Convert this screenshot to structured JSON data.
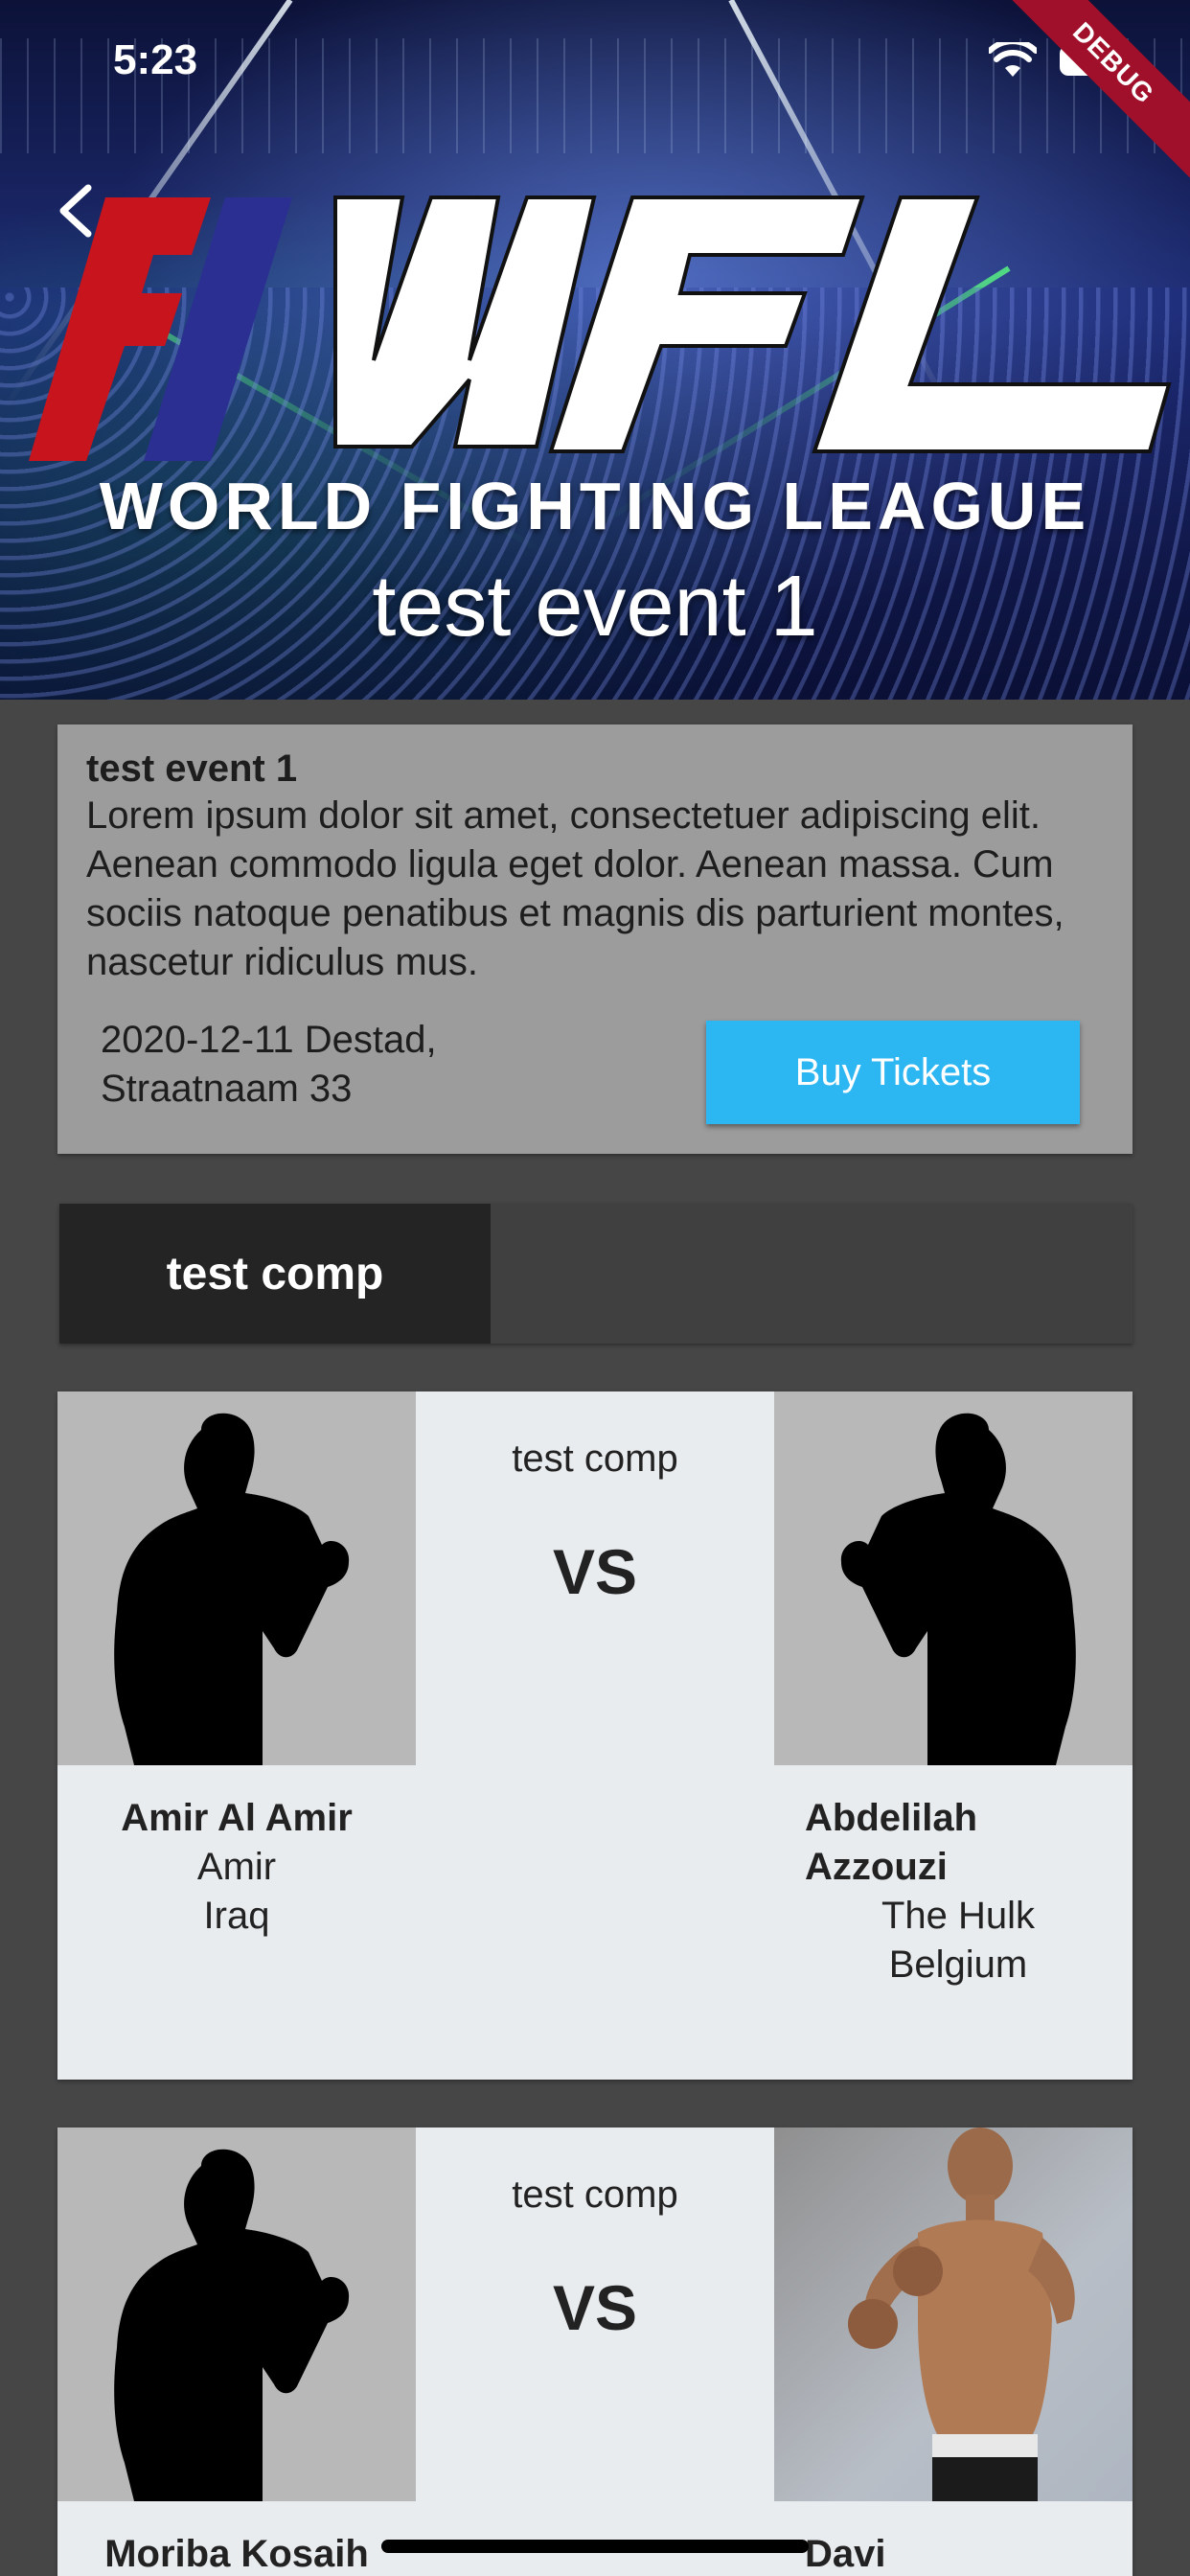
{
  "status_bar": {
    "time": "5:23",
    "debug_banner": "DEBUG"
  },
  "hero": {
    "logo_text": "WFL",
    "league_name": "WORLD FIGHTING LEAGUE",
    "event_title": "test event 1"
  },
  "event_info": {
    "title": "test event 1",
    "description": "Lorem ipsum dolor sit amet, consectetuer adipiscing elit. Aenean commodo ligula eget dolor. Aenean massa. Cum sociis natoque penatibus et magnis dis parturient montes, nascetur ridiculus mus.",
    "date_location_line1": "2020-12-11 Destad,",
    "date_location_line2": "Straatnaam 33",
    "buy_button_label": "Buy Tickets",
    "buy_button_color": "#2cb6f2"
  },
  "tabs": [
    {
      "label": "test comp",
      "active": true
    }
  ],
  "fights": [
    {
      "competition": "test comp",
      "vs": "VS",
      "left": {
        "name": "Amir Al Amir",
        "nickname": "Amir",
        "country": "Iraq",
        "photo": "silhouette"
      },
      "right": {
        "name_line1": "Abdelilah",
        "name_line2": "Azzouzi",
        "nickname": "The Hulk",
        "country": "Belgium",
        "photo": "silhouette"
      }
    },
    {
      "competition": "test comp",
      "vs": "VS",
      "left": {
        "name": "Moriba Kosaih",
        "photo": "silhouette"
      },
      "right": {
        "name": "Davi",
        "photo": "photo"
      }
    }
  ]
}
